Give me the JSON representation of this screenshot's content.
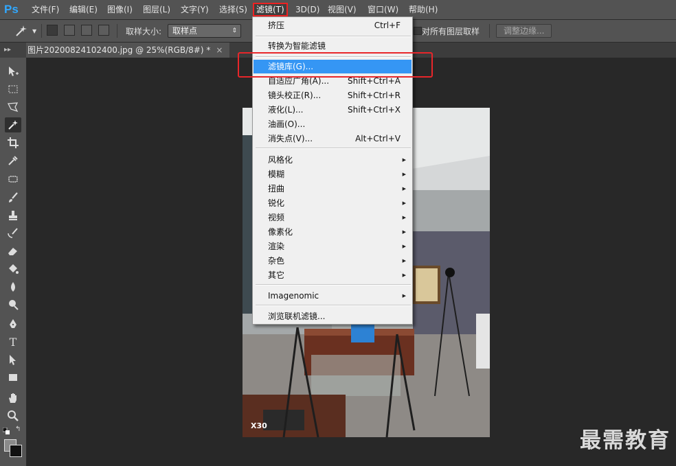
{
  "menubar": {
    "logo": "Ps",
    "items": [
      {
        "label": "文件(F)",
        "active": false
      },
      {
        "label": "编辑(E)",
        "active": false
      },
      {
        "label": "图像(I)",
        "active": false
      },
      {
        "label": "图层(L)",
        "active": false
      },
      {
        "label": "文字(Y)",
        "active": false
      },
      {
        "label": "选择(S)",
        "active": false
      },
      {
        "label": "滤镜(T)",
        "active": true
      },
      {
        "label": "3D(D)",
        "active": false
      },
      {
        "label": "视图(V)",
        "active": false
      },
      {
        "label": "窗口(W)",
        "active": false
      },
      {
        "label": "帮助(H)",
        "active": false
      }
    ]
  },
  "options_bar": {
    "sample_size_label": "取样大小:",
    "sample_size_value": "取样点",
    "sample_all_layers_label": "对所有图层取样",
    "refine_edge_label": "调整边缘..."
  },
  "tabs": {
    "document_title": "图片20200824102400.jpg @ 25%(RGB/8#) *",
    "close_glyph": "×",
    "grip_glyph": "▸▸"
  },
  "filter_menu": {
    "items": [
      {
        "label": "挤压",
        "shortcut": "Ctrl+F"
      },
      {
        "label": "转换为智能滤镜"
      },
      {
        "label": "滤镜库(G)...",
        "highlighted": true
      },
      {
        "label": "自适应广角(A)...",
        "shortcut": "Shift+Ctrl+A"
      },
      {
        "label": "镜头校正(R)...",
        "shortcut": "Shift+Ctrl+R"
      },
      {
        "label": "液化(L)...",
        "shortcut": "Shift+Ctrl+X"
      },
      {
        "label": "油画(O)..."
      },
      {
        "label": "消失点(V)...",
        "shortcut": "Alt+Ctrl+V"
      },
      {
        "label": "风格化",
        "submenu": true
      },
      {
        "label": "模糊",
        "submenu": true
      },
      {
        "label": "扭曲",
        "submenu": true
      },
      {
        "label": "锐化",
        "submenu": true
      },
      {
        "label": "视频",
        "submenu": true
      },
      {
        "label": "像素化",
        "submenu": true
      },
      {
        "label": "渲染",
        "submenu": true
      },
      {
        "label": "杂色",
        "submenu": true
      },
      {
        "label": "其它",
        "submenu": true
      },
      {
        "label": "Imagenomic",
        "submenu": true
      },
      {
        "label": "浏览联机滤镜..."
      }
    ],
    "submenu_glyph": "▶"
  },
  "canvas": {
    "photo_watermark": "X30",
    "site_watermark": "最需教育"
  },
  "colors": {
    "accent_highlight": "#3596f4",
    "annotation_red": "#e8262a",
    "ps_blue": "#31a8ff"
  }
}
